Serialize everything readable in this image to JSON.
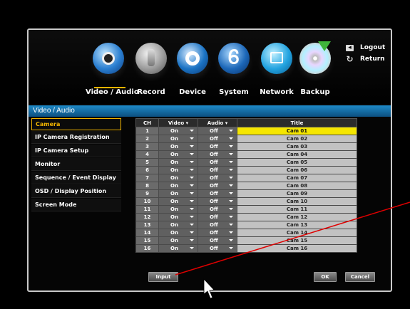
{
  "nav": {
    "items": [
      {
        "label": "Video / Audio",
        "icon": "camera-lens-icon"
      },
      {
        "label": "Record",
        "icon": "joystick-icon"
      },
      {
        "label": "Device",
        "icon": "power-icon"
      },
      {
        "label": "System",
        "icon": "gear-s-icon"
      },
      {
        "label": "Network",
        "icon": "network-icon"
      },
      {
        "label": "Backup",
        "icon": "disc-icon"
      }
    ]
  },
  "top_links": {
    "logout": "Logout",
    "return": "Return"
  },
  "page_title": "Video / Audio",
  "sidebar": {
    "items": [
      {
        "label": "Camera"
      },
      {
        "label": "IP Camera Registration"
      },
      {
        "label": "IP Camera Setup"
      },
      {
        "label": "Monitor"
      },
      {
        "label": "Sequence / Event Display"
      },
      {
        "label": "OSD / Display Position"
      },
      {
        "label": "Screen Mode"
      }
    ]
  },
  "table": {
    "headers": {
      "ch": "CH",
      "video": "Video",
      "audio": "Audio",
      "title": "Title"
    },
    "rows": [
      {
        "ch": "1",
        "video": "On",
        "audio": "Off",
        "title": "Cam 01"
      },
      {
        "ch": "2",
        "video": "On",
        "audio": "Off",
        "title": "Cam 02"
      },
      {
        "ch": "3",
        "video": "On",
        "audio": "Off",
        "title": "Cam 03"
      },
      {
        "ch": "4",
        "video": "On",
        "audio": "Off",
        "title": "Cam 04"
      },
      {
        "ch": "5",
        "video": "On",
        "audio": "Off",
        "title": "Cam 05"
      },
      {
        "ch": "6",
        "video": "On",
        "audio": "Off",
        "title": "Cam 06"
      },
      {
        "ch": "7",
        "video": "On",
        "audio": "Off",
        "title": "Cam 07"
      },
      {
        "ch": "8",
        "video": "On",
        "audio": "Off",
        "title": "Cam 08"
      },
      {
        "ch": "9",
        "video": "On",
        "audio": "Off",
        "title": "Cam 09"
      },
      {
        "ch": "10",
        "video": "On",
        "audio": "Off",
        "title": "Cam 10"
      },
      {
        "ch": "11",
        "video": "On",
        "audio": "Off",
        "title": "Cam 11"
      },
      {
        "ch": "12",
        "video": "On",
        "audio": "Off",
        "title": "Cam 12"
      },
      {
        "ch": "13",
        "video": "On",
        "audio": "Off",
        "title": "Cam 13"
      },
      {
        "ch": "14",
        "video": "On",
        "audio": "Off",
        "title": "Cam 14"
      },
      {
        "ch": "15",
        "video": "On",
        "audio": "Off",
        "title": "Cam 15"
      },
      {
        "ch": "16",
        "video": "On",
        "audio": "Off",
        "title": "Cam 16"
      }
    ]
  },
  "buttons": {
    "input": "Input",
    "ok": "OK",
    "cancel": "Cancel"
  },
  "colors": {
    "accent": "#f2b400",
    "title_bar": "#1e8ac8",
    "selected_row": "#f5e600",
    "annotation": "#e00000"
  }
}
